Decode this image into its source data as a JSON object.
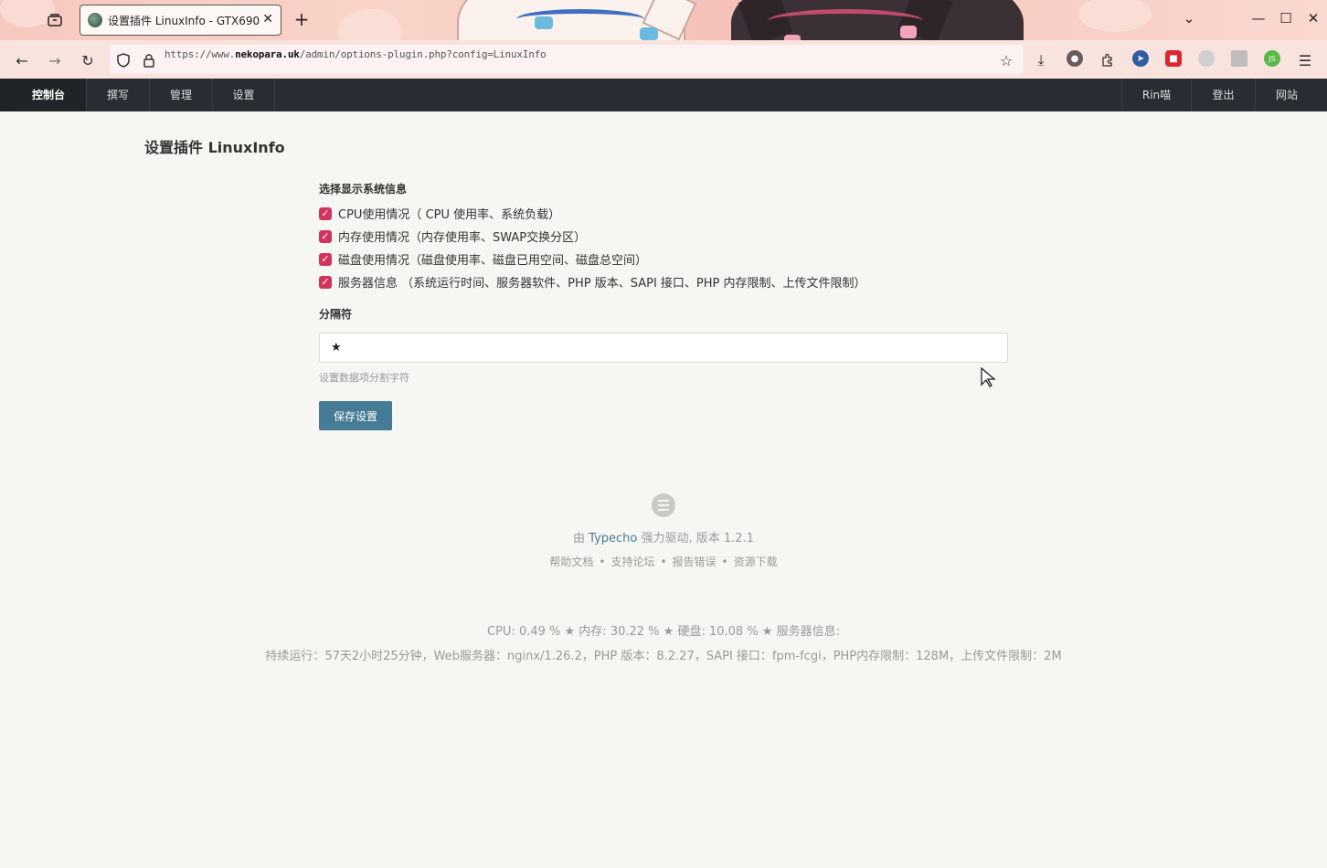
{
  "browser": {
    "tab_title": "设置插件 LinuxInfo - GTX690",
    "tab_close": "✕",
    "new_tab": "+",
    "url_prefix": "https://www.",
    "url_domain": "nekopara.uk",
    "url_path": "/admin/options-plugin.php?config=LinuxInfo",
    "icons": [
      "tab-list-icon",
      "back-icon",
      "forward-icon",
      "reload-icon",
      "shield-icon",
      "lock-icon",
      "bookmark-star-icon",
      "download-icon",
      "extension-icon",
      "puzzle-icon",
      "cursor-ext-icon",
      "ublock-icon",
      "ext-icon",
      "reader-icon",
      "js-ext-icon",
      "menu-icon",
      "chevron-down-icon",
      "minimize-icon",
      "maximize-icon",
      "close-icon"
    ]
  },
  "admin_nav": {
    "items": [
      "控制台",
      "撰写",
      "管理",
      "设置"
    ],
    "right_items": [
      "Rin喵",
      "登出",
      "网站"
    ]
  },
  "page": {
    "title": "设置插件 LinuxInfo"
  },
  "form": {
    "section_label": "选择显示系统信息",
    "options": [
      {
        "label": "CPU使用情况（ CPU 使用率、系统负载）",
        "checked": true
      },
      {
        "label": "内存使用情况（内存使用率、SWAP交换分区）",
        "checked": true
      },
      {
        "label": "磁盘使用情况（磁盘使用率、磁盘已用空间、磁盘总空间）",
        "checked": true
      },
      {
        "label": "服务器信息 （系统运行时间、服务器软件、PHP 版本、SAPI 接口、PHP 内存限制、上传文件限制）",
        "checked": true
      }
    ],
    "separator_label": "分隔符",
    "separator_value": "★",
    "separator_desc": "设置数据项分割字符",
    "save_label": "保存设置"
  },
  "footer": {
    "powered_prefix": "由 ",
    "powered_link": "Typecho",
    "powered_suffix": " 强力驱动, 版本 1.2.1",
    "links": [
      "帮助文档",
      "支持论坛",
      "报告错误",
      "资源下载"
    ],
    "stats_line1": "CPU: 0.49 % ★ 内存: 30.22 % ★ 硬盘: 10.08 % ★ 服务器信息:",
    "stats_line2": "持续运行：57天2小时25分钟，Web服务器：nginx/1.26.2，PHP 版本：8.2.27，SAPI 接口：fpm-fcgi，PHP内存限制：128M，上传文件限制：2M"
  },
  "colors": {
    "admin_nav_bg": "#292d33",
    "checkbox": "#d1335e",
    "button": "#467b96",
    "page_bg": "#f6f6f3"
  }
}
